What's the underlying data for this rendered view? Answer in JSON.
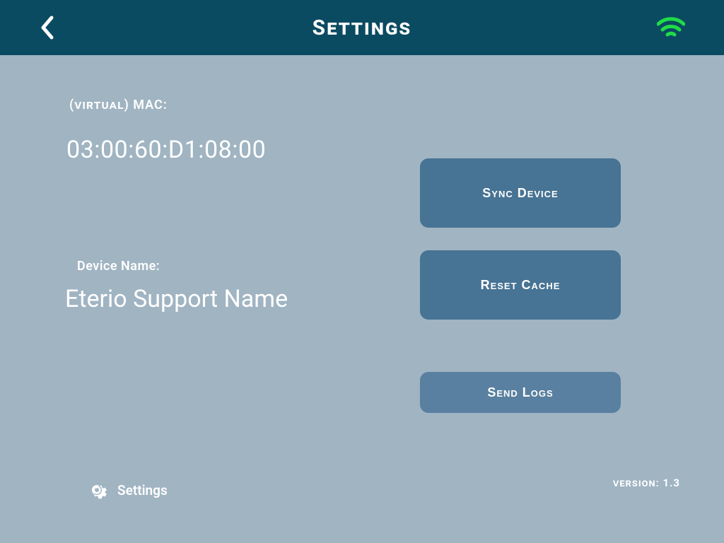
{
  "header": {
    "title": "Settings"
  },
  "mac": {
    "label_prefix": "(virtual)",
    "label_suffix": " MAC:",
    "value": "03:00:60:D1:08:00"
  },
  "device_name": {
    "label": "Device Name:",
    "value": "Eterio Support Name"
  },
  "buttons": {
    "sync": "Sync Device",
    "reset": "Reset Cache",
    "logs": "Send Logs"
  },
  "footer": {
    "settings_label": "Settings",
    "version_label": "version:",
    "version_value": "1.3"
  },
  "colors": {
    "header_bg": "#0b4b62",
    "body_bg": "#a0b4c2",
    "button_bg": "#477394",
    "wifi": "#1fdc46"
  }
}
